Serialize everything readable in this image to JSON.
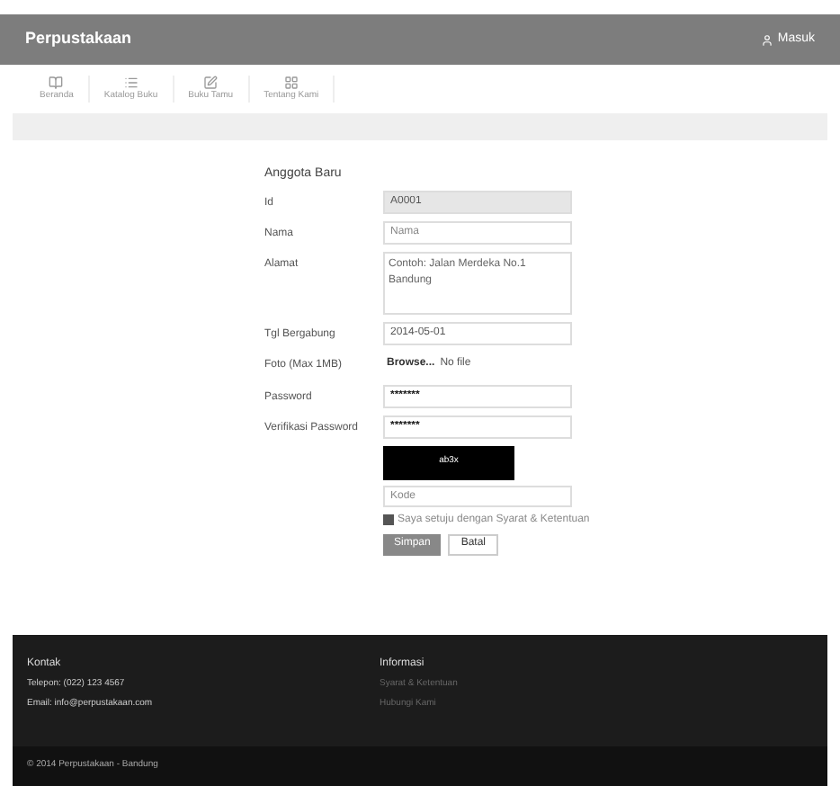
{
  "header": {
    "brand": "Perpustakaan",
    "user": "Masuk"
  },
  "toolbar": [
    {
      "label": "Beranda"
    },
    {
      "label": "Katalog Buku"
    },
    {
      "label": "Buku Tamu"
    },
    {
      "label": "Tentang Kami"
    }
  ],
  "form": {
    "title": "Anggota Baru",
    "fields": [
      {
        "kind": "readonly",
        "label": "Id",
        "value": "A0001"
      },
      {
        "kind": "text",
        "label": "Nama",
        "placeholder": "Nama"
      },
      {
        "kind": "textarea",
        "label": "Alamat",
        "placeholder": "Contoh: Jalan Merdeka No.1 Bandung"
      },
      {
        "kind": "text",
        "label": "Tgl Bergabung",
        "value": "2014-05-01"
      },
      {
        "kind": "file",
        "label": "Foto (Max 1MB)",
        "button": "Browse...",
        "note": "No file"
      },
      {
        "kind": "password",
        "label": "Password",
        "value": "*******"
      },
      {
        "kind": "password",
        "label": "Verifikasi Password",
        "value": "*******"
      }
    ],
    "captcha": "ab3x",
    "captcha_placeholder": "Kode",
    "agree": {
      "checked": true,
      "text": "Saya setuju dengan Syarat & Ketentuan"
    },
    "buttons": [
      {
        "label": "Simpan",
        "kind": "primary"
      },
      {
        "label": "Batal",
        "kind": "default"
      }
    ]
  },
  "footer": {
    "columns": [
      {
        "title": "Kontak",
        "lines": [
          "Telepon: (022) 123 4567",
          "Email: info@perpustakaan.com"
        ]
      },
      {
        "title": "Informasi",
        "lines": [
          "Syarat & Ketentuan",
          "Hubungi Kami"
        ]
      }
    ],
    "copyright": "© 2014 Perpustakaan - Bandung"
  }
}
